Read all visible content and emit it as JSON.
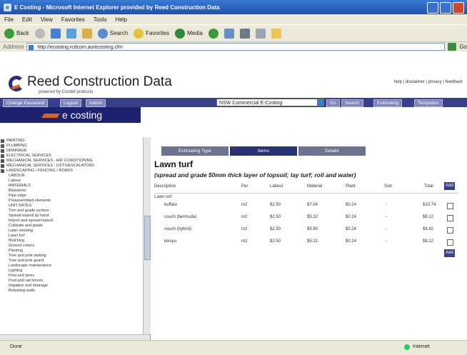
{
  "window": {
    "title": "E Costing - Microsoft Internet Explorer provided by Reed Construction Data"
  },
  "menu": [
    "File",
    "Edit",
    "View",
    "Favorites",
    "Tools",
    "Help"
  ],
  "toolbar": {
    "back": "Back",
    "search": "Search",
    "favorites": "Favorites",
    "media": "Media"
  },
  "address": {
    "label": "Address",
    "url": "http://ecosting.rcdcom.au/ecosting.cfm",
    "go": "Go"
  },
  "site": {
    "brand": "Reed Construction Data",
    "powered": "powered by Cordell products",
    "toplinks": "help | disclaimer | privacy | feedback",
    "nav": {
      "change_password": "Change Password",
      "logout": "Logout",
      "admin": "Admin"
    },
    "select": "NSW Commercial E-Costing",
    "go": "Go",
    "search": "Search",
    "estimating": "Estimating",
    "templates": "Templates",
    "app_name": "e costing"
  },
  "tree": {
    "top_items": [
      "PAINTING",
      "PLUMBING",
      "DRAINAGE",
      "ELECTRICAL SERVICES",
      "MECHANICAL SERVICES - AIR CONDITIONING",
      "MECHANICAL SERVICES - LIFTS/ESCALATORS",
      "LANDSCAPING / FENCING / ROADS"
    ],
    "children": [
      "LABOUR",
      "Labour",
      "MATERIALS",
      "Bluestone",
      "Pipe edge",
      "Preassembled elements",
      "UNIT RATES",
      "Trim and grade surface",
      "Spread topsoil by hand",
      "Import and spread topsoil",
      "Cultivate and grade",
      "Lawn seeding",
      "Lawn turf",
      "Mulching",
      "Ground covers",
      "Planting",
      "Tree and pole staking",
      "Tree and pole guard",
      "Landscape maintenance",
      "Lighting",
      "Post and wires",
      "Post and rail fences",
      "Irrigation and drainage",
      "Retaining walls"
    ]
  },
  "tabs": [
    "Estimating Type",
    "Items",
    "Details"
  ],
  "content": {
    "title": "Lawn turf",
    "subtitle": "(spread and grade 50mm thick layer of topsoil; lay turf; roll and water)",
    "headers": {
      "description": "Description",
      "per": "Per",
      "labour": "Labour",
      "material": "Material",
      "plant": "Plant",
      "sub": "Sub",
      "total": "Total",
      "add": "Add"
    },
    "group": "Lawn turf",
    "rows": [
      {
        "description": "buffalo",
        "per": "m2",
        "labour": "$2.50",
        "material": "$7.04",
        "plant": "$0.24",
        "sub": "-",
        "total": "$10.74"
      },
      {
        "description": "couch (bermuda)",
        "per": "m2",
        "labour": "$2.50",
        "material": "$5.32",
        "plant": "$0.24",
        "sub": "-",
        "total": "$8.12"
      },
      {
        "description": "couch (hybrid)",
        "per": "m2",
        "labour": "$2.50",
        "material": "$5.90",
        "plant": "$0.24",
        "sub": "-",
        "total": "$8.82"
      },
      {
        "description": "kikuyu",
        "per": "m2",
        "labour": "$2.50",
        "material": "$5.32",
        "plant": "$0.24",
        "sub": "-",
        "total": "$8.12"
      }
    ],
    "add_bottom": "Add"
  },
  "status": {
    "left": "Done",
    "right": "Internet"
  }
}
